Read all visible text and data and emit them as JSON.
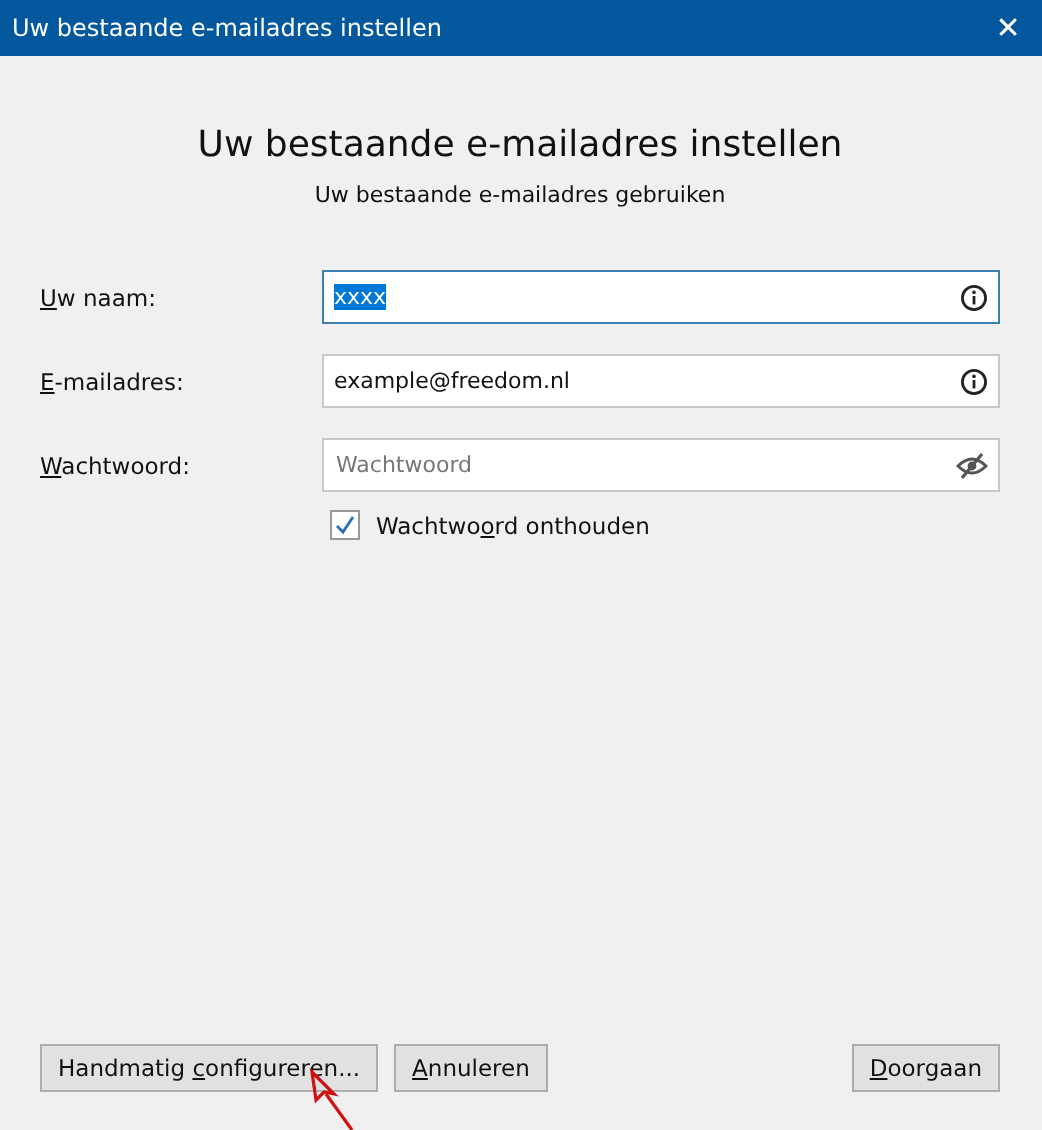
{
  "window": {
    "title": "Uw bestaande e-mailadres instellen",
    "close": "✕"
  },
  "heading": "Uw bestaande e-mailadres instellen",
  "subheading": "Uw bestaande e-mailadres gebruiken",
  "fields": [
    {
      "label": {
        "key": "U",
        "post": "w naam:"
      },
      "value": "xxxx",
      "value_selected": true,
      "focused": true,
      "kind": "info"
    },
    {
      "label": {
        "key": "E",
        "post": "-mailadres:"
      },
      "value": "example@freedom.nl",
      "value_selected": false,
      "focused": false,
      "kind": "info"
    },
    {
      "label": {
        "key": "W",
        "post": "achtwoord:"
      },
      "placeholder": "Wachtwoord",
      "focused": false,
      "kind": "password"
    }
  ],
  "remember": {
    "label": {
      "pre": "Wachtwo",
      "key": "o",
      "post": "rd onthouden"
    },
    "checked": true
  },
  "left_buttons": [
    {
      "label": {
        "pre": "Handmatig ",
        "key": "c",
        "post": "onfigureren..."
      }
    },
    {
      "label": {
        "key": "A",
        "post": "nnuleren"
      }
    }
  ],
  "right_buttons": [
    {
      "label": {
        "key": "D",
        "post": "oorgaan"
      }
    }
  ]
}
